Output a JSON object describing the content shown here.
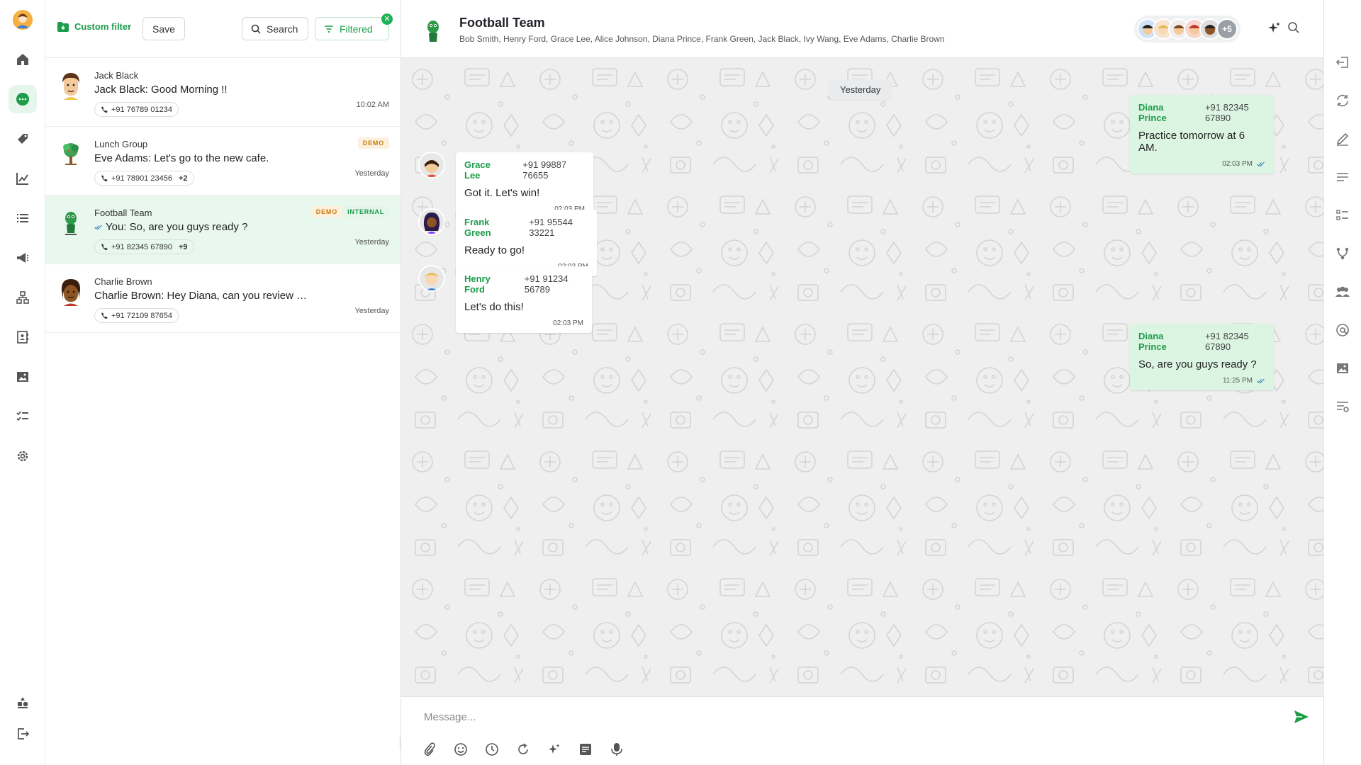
{
  "rail": {
    "items": [
      {
        "name": "home"
      },
      {
        "name": "chats"
      },
      {
        "name": "tags"
      },
      {
        "name": "analytics"
      },
      {
        "name": "lists"
      },
      {
        "name": "broadcast"
      },
      {
        "name": "flows"
      },
      {
        "name": "contacts-book"
      },
      {
        "name": "media"
      },
      {
        "name": "tasks"
      },
      {
        "name": "settings"
      }
    ],
    "active": "chats"
  },
  "toolbar": {
    "custom_filter_label": "Custom filter",
    "save_label": "Save",
    "search_label": "Search",
    "filtered_label": "Filtered"
  },
  "chats": [
    {
      "name": "Jack Black",
      "message": "Jack Black: Good Morning !!",
      "phone": "+91 76789 01234",
      "extra": "",
      "time": "10:02 AM",
      "tags": []
    },
    {
      "name": "Lunch Group",
      "message": "Eve Adams: Let's go to the new cafe.",
      "phone": "+91 78901 23456",
      "extra": "+2",
      "time": "Yesterday",
      "tags": [
        "DEMO"
      ]
    },
    {
      "name": "Football Team",
      "message": "You: So, are you guys ready ?",
      "phone": "+91 82345 67890",
      "extra": "+9",
      "time": "Yesterday",
      "tags": [
        "DEMO",
        "INTERNAL"
      ]
    },
    {
      "name": "Charlie Brown",
      "message": "Charlie Brown: Hey Diana, can you review …",
      "phone": "+91 72109 87654",
      "extra": "",
      "time": "Yesterday",
      "tags": []
    }
  ],
  "conversation": {
    "title": "Football Team",
    "members": "Bob Smith, Henry Ford, Grace Lee, Alice Johnson, Diana Prince, Frank Green, Jack Black, Ivy Wang, Eve Adams, Charlie Brown",
    "more_count": "+5",
    "date_label": "Yesterday",
    "messages": [
      {
        "direction": "out",
        "sender": "Diana Prince",
        "phone": "+91 82345 67890",
        "text": "Practice tomorrow at 6 AM.",
        "time": "02:03 PM"
      },
      {
        "direction": "in",
        "sender": "Grace Lee",
        "phone": "+91 99887 76655",
        "text": "Got it. Let's win!",
        "time": "02:03 PM"
      },
      {
        "direction": "in",
        "sender": "Frank Green",
        "phone": "+91 95544 33221",
        "text": "Ready to go!",
        "time": "02:03 PM"
      },
      {
        "direction": "in",
        "sender": "Henry Ford",
        "phone": "+91 91234 56789",
        "text": "Let's do this!",
        "time": "02:03 PM"
      },
      {
        "direction": "out",
        "sender": "Diana Prince",
        "phone": "+91 82345 67890",
        "text": "So, are you guys ready ?",
        "time": "11:25 PM"
      }
    ],
    "composer_placeholder": "Message..."
  },
  "colors": {
    "accent": "#1d9c4a",
    "outgoing_bubble": "#dcf5e2",
    "selected_row": "#e8f8ee"
  }
}
